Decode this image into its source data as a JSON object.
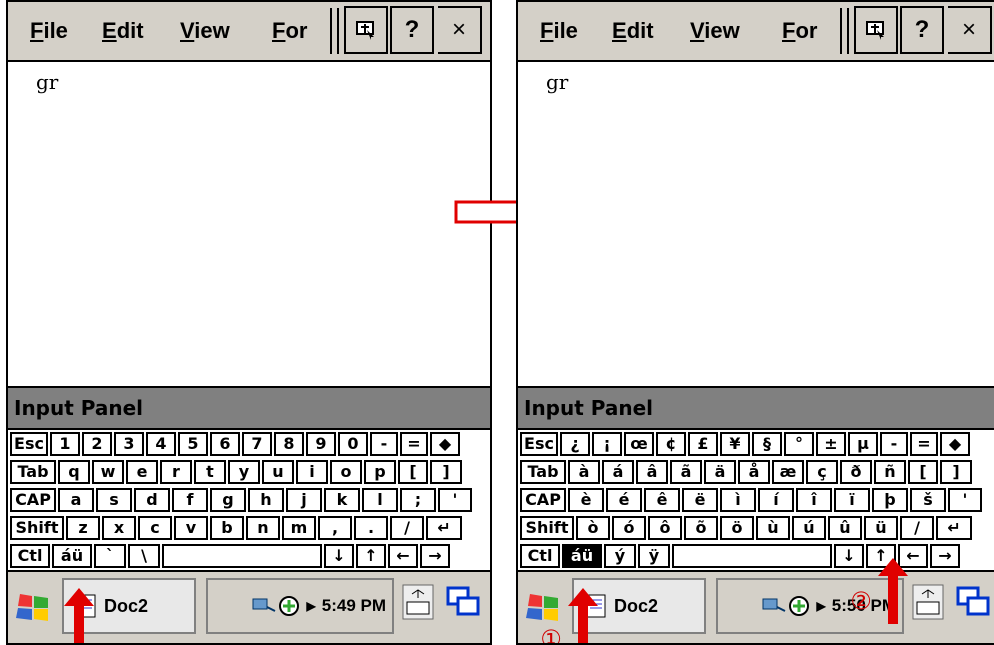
{
  "menu": {
    "file": "File",
    "edit": "Edit",
    "view": "View",
    "format": "For"
  },
  "toolbar": {
    "help": "?",
    "close": "×"
  },
  "document": {
    "text": "gr"
  },
  "input_panel": {
    "title": "Input Panel"
  },
  "left": {
    "keyboard": {
      "rows": [
        [
          "Esc",
          "1",
          "2",
          "3",
          "4",
          "5",
          "6",
          "7",
          "8",
          "9",
          "0",
          "-",
          "=",
          "◆"
        ],
        [
          "Tab",
          "q",
          "w",
          "e",
          "r",
          "t",
          "y",
          "u",
          "i",
          "o",
          "p",
          "[",
          "]"
        ],
        [
          "CAP",
          "a",
          "s",
          "d",
          "f",
          "g",
          "h",
          "j",
          "k",
          "l",
          ";",
          "'"
        ],
        [
          "Shift",
          "z",
          "x",
          "c",
          "v",
          "b",
          "n",
          "m",
          ",",
          ".",
          "/",
          "↵"
        ],
        [
          "Ctl",
          "áü",
          "`",
          "\\",
          "",
          "↓",
          "↑",
          "←",
          "→"
        ]
      ]
    },
    "taskbar": {
      "doc_label": "Doc2",
      "time": "5:49 PM"
    }
  },
  "right": {
    "keyboard": {
      "rows": [
        [
          "Esc",
          "¿",
          "¡",
          "œ",
          "¢",
          "£",
          "¥",
          "§",
          "°",
          "±",
          "µ",
          "-",
          "=",
          "◆"
        ],
        [
          "Tab",
          "à",
          "á",
          "â",
          "ã",
          "ä",
          "å",
          "æ",
          "ç",
          "ð",
          "ñ",
          "[",
          "]"
        ],
        [
          "CAP",
          "è",
          "é",
          "ê",
          "ë",
          "ì",
          "í",
          "î",
          "ï",
          "þ",
          "š",
          "'"
        ],
        [
          "Shift",
          "ò",
          "ó",
          "ô",
          "õ",
          "ö",
          "ù",
          "ú",
          "û",
          "ü",
          "/",
          "↵"
        ],
        [
          "Ctl",
          "áü",
          "ý",
          "ÿ",
          "",
          "↓",
          "↑",
          "←",
          "→"
        ]
      ]
    },
    "taskbar": {
      "doc_label": "Doc2",
      "time": "5:50 PM"
    },
    "callouts": {
      "step1": "①",
      "step2": "②"
    }
  },
  "colors": {
    "title_bar_gray": "#d4d0c8",
    "panel_gray": "#808080",
    "arrow_red": "#e00000"
  }
}
